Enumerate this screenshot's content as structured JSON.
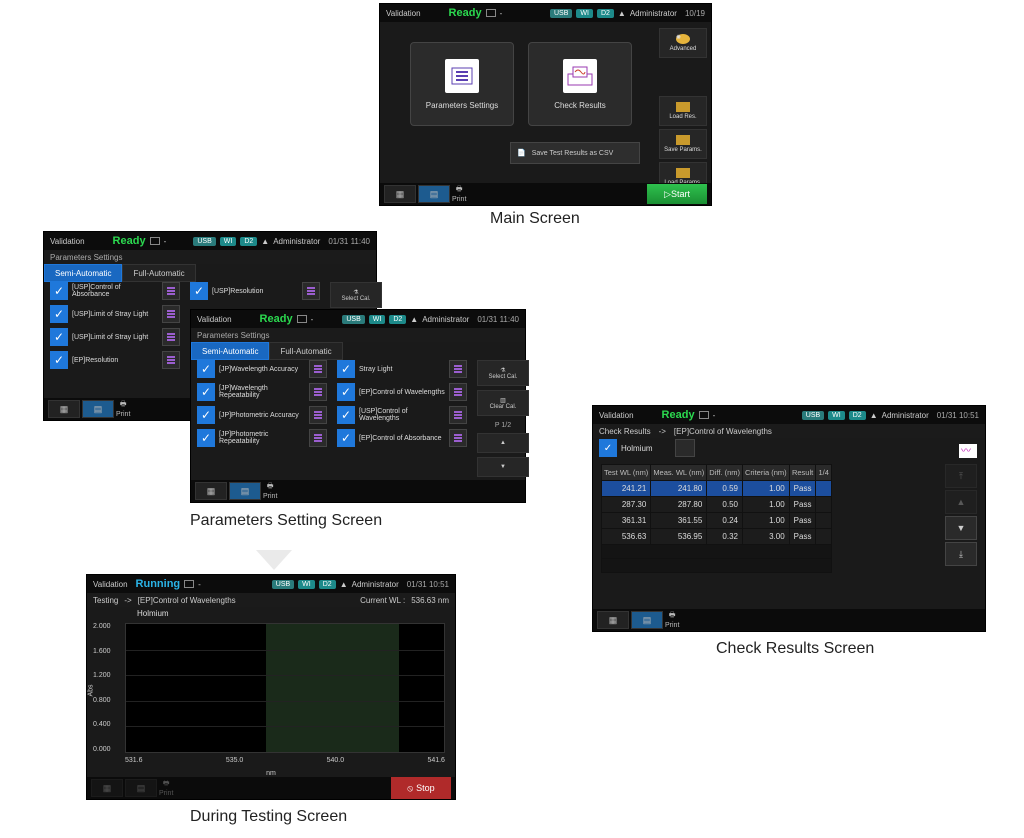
{
  "captions": {
    "main": "Main Screen",
    "params": "Parameters Setting Screen",
    "testing": "During Testing Screen",
    "results": "Check Results Screen"
  },
  "common": {
    "app_title": "Validation",
    "user": "Administrator",
    "usb": "USB",
    "wi": "WI",
    "d2": "D2",
    "print": "Print"
  },
  "main": {
    "status": "Ready",
    "datetime": "10/19",
    "card_params": "Parameters Settings",
    "card_results": "Check Results",
    "csv": "Save Test Results as CSV",
    "advanced": "Advanced",
    "load_res": "Load Res.",
    "save_params": "Save Params.",
    "load_params": "Load Params.",
    "start": "Start"
  },
  "params1": {
    "status": "Ready",
    "datetime": "01/31 11:40",
    "subtitle": "Parameters Settings",
    "tab_semi": "Semi-Automatic",
    "tab_full": "Full-Automatic",
    "left": [
      "[USP]Control of Absorbance",
      "[USP]Limit of Stray Light",
      "[USP]Limit of Stray Light",
      "[EP]Resolution"
    ],
    "right_top": "[USP]Resolution",
    "select_cal": "Select Cal."
  },
  "params2": {
    "status": "Ready",
    "datetime": "01/31 11:40",
    "subtitle": "Parameters Settings",
    "tab_semi": "Semi-Automatic",
    "tab_full": "Full-Automatic",
    "col1": [
      "[JP]Wavelength Accuracy",
      "[JP]Wavelength Repeatability",
      "[JP]Photometric Accuracy",
      "[JP]Photometric Repeatability"
    ],
    "col2": [
      "Stray Light",
      "[EP]Control of Wavelengths",
      "[USP]Control of Wavelengths",
      "[EP]Control of Absorbance"
    ],
    "select_cal": "Select Cal.",
    "clear_cal": "Clear Cal.",
    "pager": "P 1/2"
  },
  "testing": {
    "status": "Running",
    "datetime": "01/31 10:51",
    "breadcrumb_mode": "Testing",
    "breadcrumb_item": "[EP]Control of Wavelengths",
    "current_label": "Current WL :",
    "current_value": "536.63 nm",
    "spectrum_label": "Holmium",
    "ylabel": "Abs",
    "xlabel": "nm",
    "yticks": [
      "2.000",
      "1.600",
      "1.200",
      "0.800",
      "0.400",
      "0.000"
    ],
    "xticks": [
      "531.6",
      "535.0",
      "540.0",
      "541.6"
    ],
    "stop": "Stop"
  },
  "results": {
    "status": "Ready",
    "datetime": "01/31 10:51",
    "breadcrumb_mode": "Check Results",
    "breadcrumb_item": "[EP]Control of Wavelengths",
    "selected_label": "Holmium",
    "page": "1/4",
    "headers": [
      "Test WL (nm)",
      "Meas. WL (nm)",
      "Diff. (nm)",
      "Criteria (nm)",
      "Result"
    ],
    "rows": [
      {
        "test": "241.21",
        "meas": "241.80",
        "diff": "0.59",
        "crit": "1.00",
        "res": "Pass",
        "sel": true
      },
      {
        "test": "287.30",
        "meas": "287.80",
        "diff": "0.50",
        "crit": "1.00",
        "res": "Pass"
      },
      {
        "test": "361.31",
        "meas": "361.55",
        "diff": "0.24",
        "crit": "1.00",
        "res": "Pass"
      },
      {
        "test": "536.63",
        "meas": "536.95",
        "diff": "0.32",
        "crit": "3.00",
        "res": "Pass"
      }
    ]
  },
  "chart_data": {
    "type": "line",
    "title": "Holmium",
    "xlabel": "nm",
    "ylabel": "Abs",
    "xlim": [
      531.6,
      541.6
    ],
    "ylim": [
      0.0,
      2.0
    ],
    "yticks": [
      0.0,
      0.4,
      0.8,
      1.2,
      1.6,
      2.0
    ],
    "xticks": [
      531.6,
      535.0,
      540.0,
      541.6
    ],
    "highlight_band_x": [
      536.0,
      540.0
    ],
    "series": [
      {
        "name": "Holmium",
        "x": [],
        "y": []
      }
    ],
    "note": "No plotted trace visible; scan in progress at 536.63 nm"
  }
}
